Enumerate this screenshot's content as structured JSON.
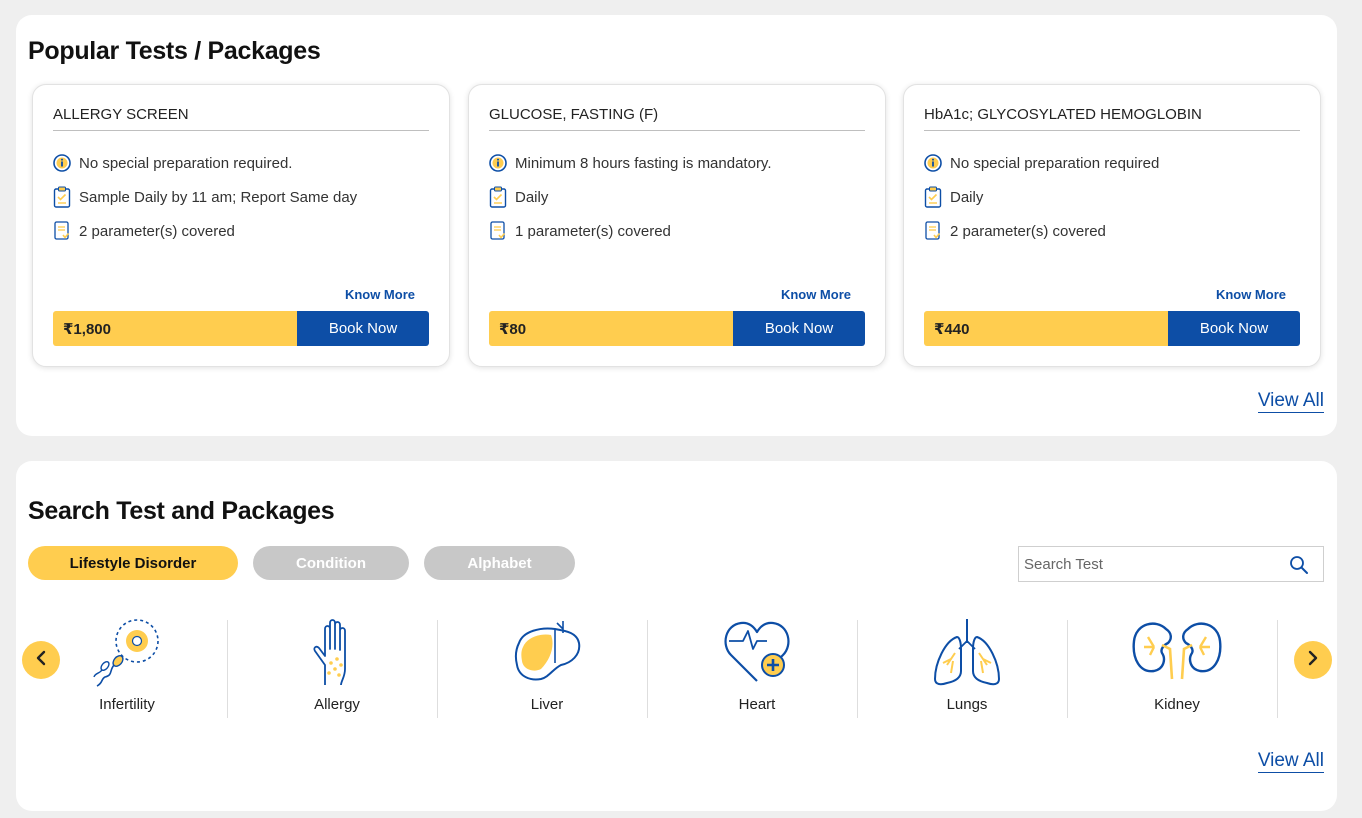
{
  "popular": {
    "title": "Popular Tests / Packages",
    "view_all": "View All",
    "cards": [
      {
        "title": "ALLERGY SCREEN",
        "preparation": "No special preparation required.",
        "schedule": "Sample Daily by 11 am; Report Same day",
        "parameters": "2 parameter(s) covered",
        "know_more": "Know More",
        "price": "₹1,800",
        "book_label": "Book Now"
      },
      {
        "title": "GLUCOSE, FASTING (F)",
        "preparation": "Minimum 8 hours fasting is mandatory.",
        "schedule": "Daily",
        "parameters": "1 parameter(s) covered",
        "know_more": "Know More",
        "price": "₹80",
        "book_label": "Book Now"
      },
      {
        "title": "HbA1c; GLYCOSYLATED HEMOGLOBIN",
        "preparation": "No special preparation required",
        "schedule": "Daily",
        "parameters": "2 parameter(s) covered",
        "know_more": "Know More",
        "price": "₹440",
        "book_label": "Book Now"
      }
    ]
  },
  "search": {
    "title": "Search Test and Packages",
    "tabs": [
      {
        "label": "Lifestyle Disorder",
        "active": true
      },
      {
        "label": "Condition",
        "active": false
      },
      {
        "label": "Alphabet",
        "active": false
      }
    ],
    "search_placeholder": "Search Test",
    "categories": [
      {
        "label": "Infertility",
        "icon": "infertility-icon"
      },
      {
        "label": "Allergy",
        "icon": "allergy-icon"
      },
      {
        "label": "Liver",
        "icon": "liver-icon"
      },
      {
        "label": "Heart",
        "icon": "heart-icon"
      },
      {
        "label": "Lungs",
        "icon": "lungs-icon"
      },
      {
        "label": "Kidney",
        "icon": "kidney-icon"
      }
    ],
    "view_all": "View All"
  },
  "colors": {
    "accent_yellow": "#ffcd4f",
    "brand_blue": "#0d4ea6",
    "inactive_gray": "#c8c8c8",
    "background": "#efefef"
  }
}
